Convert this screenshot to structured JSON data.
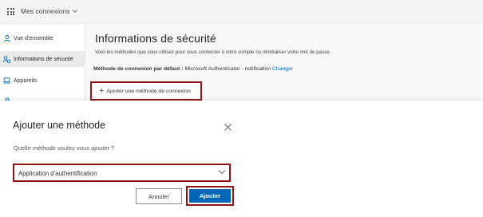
{
  "header": {
    "app_title": "Mes connexions",
    "icons": [
      "waffle-icon",
      "chevron-down-icon"
    ]
  },
  "sidebar": {
    "items": [
      {
        "label": "Vue d'ensemble",
        "icon": "person-icon",
        "active": false
      },
      {
        "label": "Informations de sécurité",
        "icon": "security-info-icon",
        "active": true
      },
      {
        "label": "Appareils",
        "icon": "laptop-icon",
        "active": false
      },
      {
        "label": "",
        "icon": "lock-icon",
        "active": false
      }
    ]
  },
  "main": {
    "title": "Informations de sécurité",
    "description": "Voici les méthodes que vous utilisez pour vous connecter à votre compte ou réinitialiser votre mot de passe.",
    "default_method_label": "Méthode de connexion par défaut :",
    "default_method_value": "Microsoft Authenticator - notification",
    "change_link": "Changer",
    "add_method_label": "Ajouter une méthode de connexion",
    "add_icon": "plus-icon"
  },
  "modal": {
    "title": "Ajouter une méthode",
    "question": "Quelle méthode voulez-vous ajouter ?",
    "select_value": "Application d'authentification",
    "cancel_label": "Annuler",
    "add_label": "Ajouter",
    "icons": [
      "close-icon",
      "chevron-down-icon"
    ]
  },
  "colors": {
    "accent": "#0067b8",
    "highlight_border": "#8e1418",
    "topbar_bg": "#f4f4f4",
    "content_bg": "#f8f8f8",
    "active_nav_bg": "#ebebeb"
  }
}
